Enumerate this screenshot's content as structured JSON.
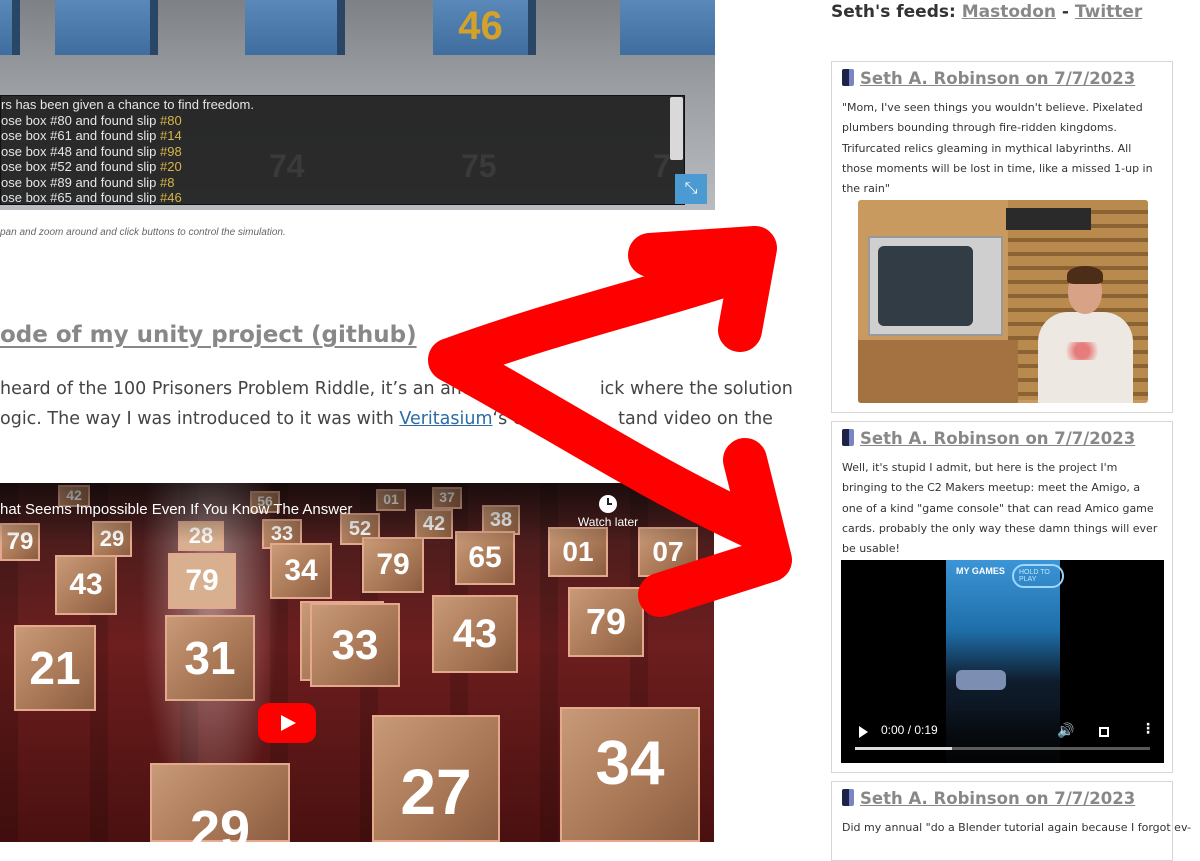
{
  "sim": {
    "highlight_number": "46",
    "ghost_numbers": [
      "74",
      "75",
      "7"
    ],
    "log": [
      {
        "text": "rs has been given a chance to find freedom.",
        "slip": ""
      },
      {
        "text": "ose box #80 and found slip ",
        "slip": "#80"
      },
      {
        "text": "ose box #61 and found slip ",
        "slip": "#14"
      },
      {
        "text": "ose box #48 and found slip ",
        "slip": "#98"
      },
      {
        "text": "ose box #52 and found slip ",
        "slip": "#20"
      },
      {
        "text": "ose box #89 and found slip ",
        "slip": "#8"
      },
      {
        "text": "ose box #65 and found slip ",
        "slip": "#46"
      }
    ],
    "caption": "pan and zoom around and click buttons to control the simulation."
  },
  "article": {
    "heading": "ode of my unity project (github)",
    "line1": "heard of the 100 Prisoners Problem Riddle, it’s an amaz",
    "line1b": "ick where the solution",
    "line2a": "ogic. The way I was introduced to it was with ",
    "line2_link": "Veritasium",
    "line2b": "‘s easy t",
    "line2c": "tand video on the"
  },
  "video": {
    "title": "hat Seems Impossible Even If You Know The Answer",
    "watch_later": "Watch later",
    "box_numbers": [
      "42",
      "56",
      "01",
      "37",
      "29",
      "43",
      "79",
      "28",
      "33",
      "52",
      "42",
      "38",
      "79",
      "34",
      "79",
      "65",
      "01",
      "07",
      "43",
      "21",
      "31",
      "33",
      "43",
      "79",
      "27",
      "34",
      "29"
    ]
  },
  "sidebar": {
    "feeds_label": "Seth's feeds:",
    "feeds_separator": "-",
    "mastodon": "Mastodon",
    "twitter": "Twitter",
    "posts": [
      {
        "author_date": "Seth A. Robinson on 7/7/2023",
        "text": "\"Mom, I've seen things you wouldn't believe. Pixelated plumbers bounding through fire-ridden kingdoms. Trifurcated relics gleaming in mythical labyrinths. All those moments will be lost in time, like a missed 1-up in the rain\""
      },
      {
        "author_date": "Seth A. Robinson on 7/7/2023",
        "text": "Well, it's stupid I admit, but here is the project I'm bringing to the C2 Makers meetup: meet the Amigo, a one of a kind \"game console\" that can read Amico game cards. probably the only way these damn things will ever be usable!",
        "video_time": "0:00 / 0:19",
        "video_label_mygames": "MY GAMES",
        "video_label_pill": "HOLD TO PLAY"
      },
      {
        "author_date": "Seth A. Robinson on 7/7/2023",
        "text": "Did my annual \"do a Blender tutorial again because I forgot ev-"
      }
    ]
  },
  "colors": {
    "arrow": "#ff0000",
    "link": "#2a6ba8",
    "muted_link": "#888888",
    "slip_highlight": "#d7b54a",
    "yt_red": "#ff0000"
  }
}
